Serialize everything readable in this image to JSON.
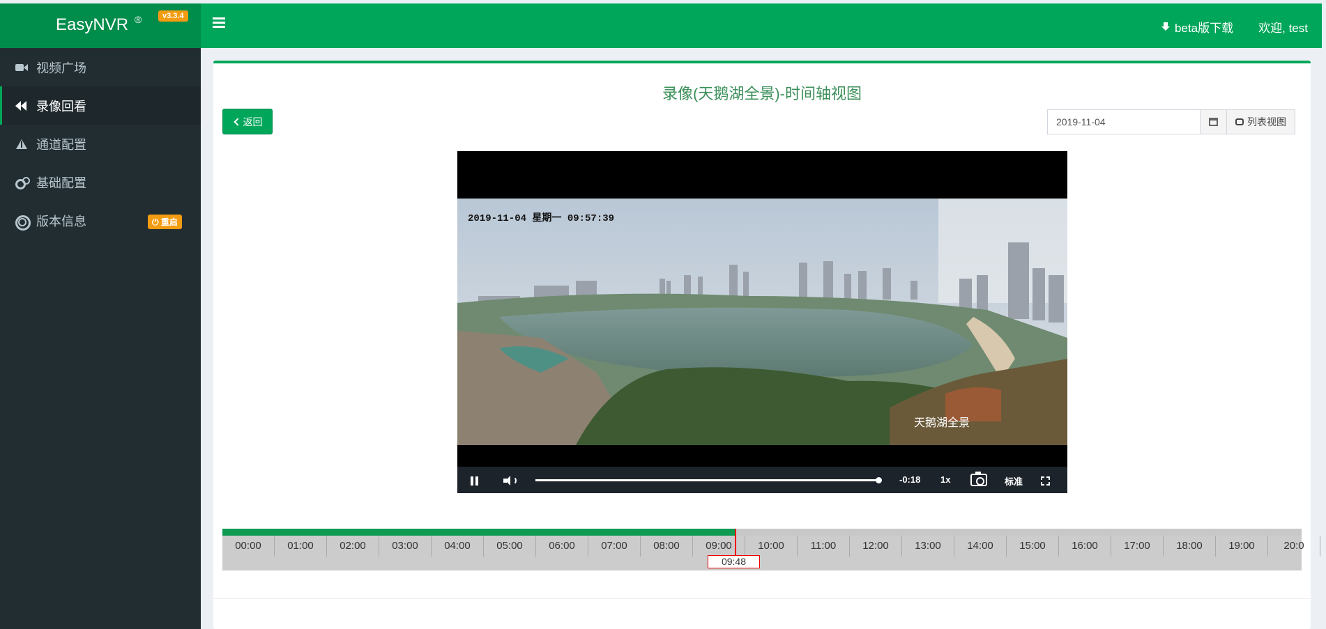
{
  "app": {
    "name": "EasyNVR",
    "reg": "®",
    "version": "v3.3.4"
  },
  "header": {
    "download_label": "beta版下载",
    "welcome": "欢迎, test"
  },
  "sidebar": {
    "items": [
      {
        "label": "视频广场",
        "icon": "video-camera-icon"
      },
      {
        "label": "录像回看",
        "icon": "backward-icon",
        "active": true
      },
      {
        "label": "通道配置",
        "icon": "road-icon"
      },
      {
        "label": "基础配置",
        "icon": "gears-icon"
      },
      {
        "label": "版本信息",
        "icon": "life-ring-icon",
        "badge": "⏻ 重启"
      }
    ]
  },
  "main": {
    "title": "录像(天鹅湖全景)-时间轴视图",
    "back_label": "返回",
    "date_value": "2019-11-04",
    "list_view_label": "列表视图"
  },
  "player": {
    "osd_timestamp": "2019-11-04 星期一 09:57:39",
    "osd_channel": "天鹅湖全景",
    "remaining": "-0:18",
    "speed": "1x",
    "quality": "标准",
    "progress": 1.0
  },
  "timeline": {
    "ticks": [
      "00:00",
      "01:00",
      "02:00",
      "03:00",
      "04:00",
      "05:00",
      "06:00",
      "07:00",
      "08:00",
      "09:00",
      "10:00",
      "11:00",
      "12:00",
      "13:00",
      "14:00",
      "15:00",
      "16:00",
      "17:00",
      "18:00",
      "19:00",
      "20:0"
    ],
    "cursor_label": "09:48",
    "recorded_until_hours": 9.8,
    "cursor_hours": 9.8
  },
  "colors": {
    "brand": "#00a65a",
    "brand_dark": "#008d4c",
    "sidebar_bg": "#222d32",
    "badge": "#f39c12",
    "cursor": "#ee0000"
  }
}
